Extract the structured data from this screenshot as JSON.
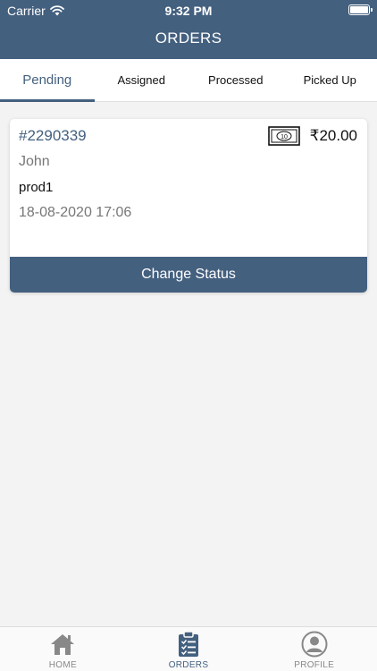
{
  "status_bar": {
    "carrier": "Carrier",
    "time": "9:32 PM"
  },
  "header": {
    "title": "ORDERS"
  },
  "tabs": [
    {
      "label": "Pending",
      "active": true
    },
    {
      "label": "Assigned",
      "active": false
    },
    {
      "label": "Processed",
      "active": false
    },
    {
      "label": "Picked Up",
      "active": false
    }
  ],
  "order": {
    "id": "#2290339",
    "price": "₹20.00",
    "cash_icon_text": "10",
    "customer": "John",
    "product": "prod1",
    "datetime": "18-08-2020 17:06",
    "action_label": "Change Status"
  },
  "bottom_nav": [
    {
      "label": "HOME",
      "icon": "home-icon"
    },
    {
      "label": "ORDERS",
      "icon": "clipboard-icon",
      "active": true
    },
    {
      "label": "PROFILE",
      "icon": "profile-icon"
    }
  ],
  "colors": {
    "primary": "#44607f",
    "background": "#f3f3f3"
  }
}
